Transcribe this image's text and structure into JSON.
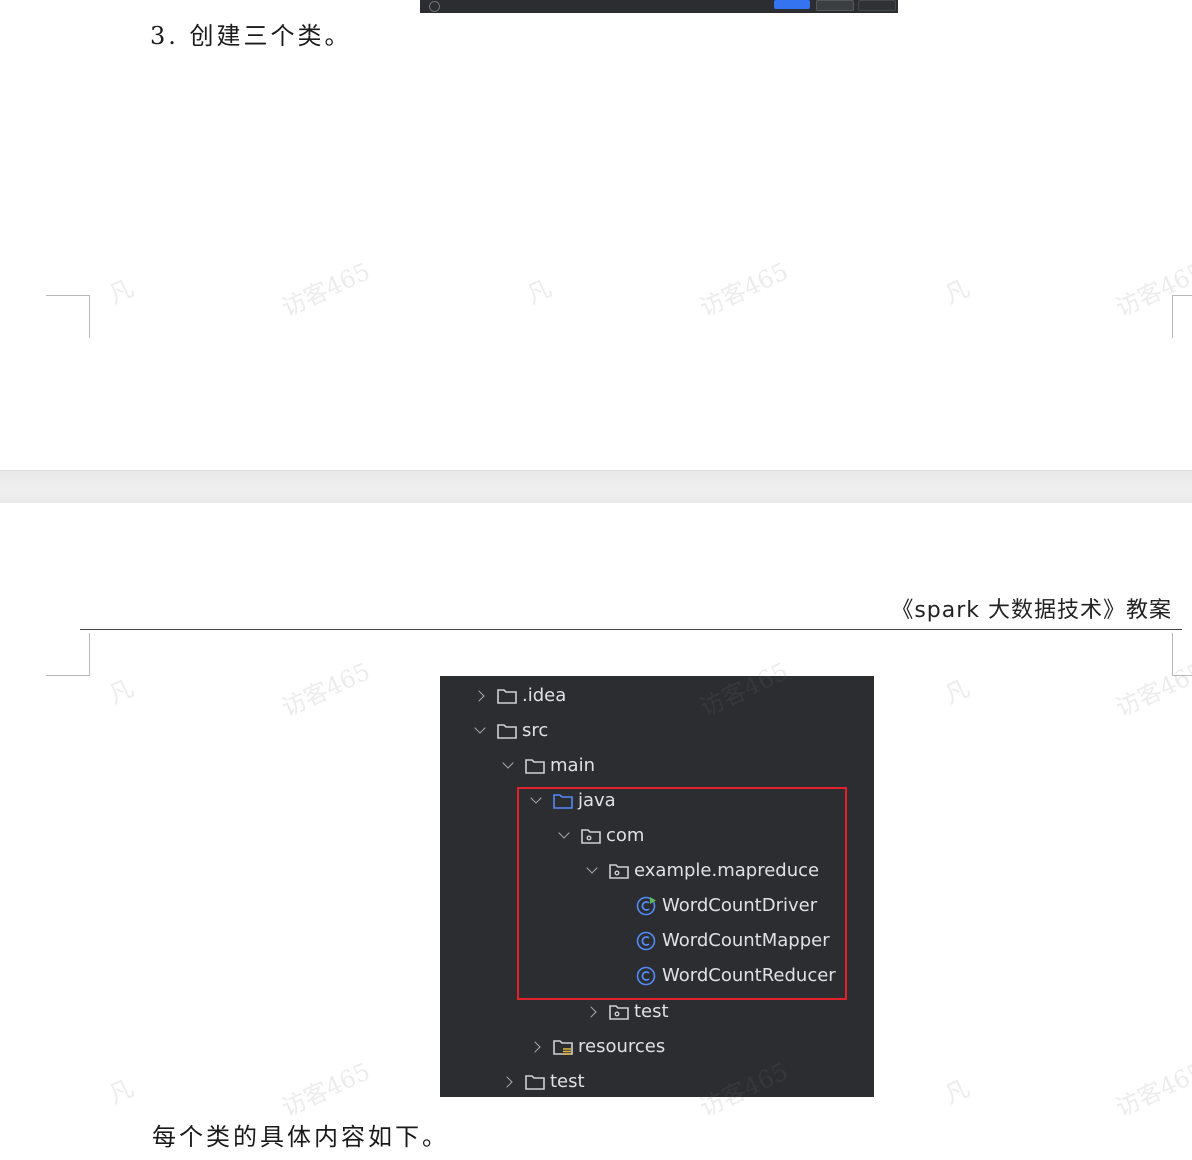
{
  "page1": {
    "step_text": "3. 创建三个类。"
  },
  "watermarks": [
    "凡",
    "访客465"
  ],
  "page2": {
    "header_text": "《spark 大数据技术》教案",
    "closing_text": "每个类的具体内容如下。"
  },
  "tree": {
    "items": [
      {
        "label": ".idea",
        "expanded": false,
        "icon": "folder-icon"
      },
      {
        "label": "src",
        "expanded": true,
        "icon": "folder-icon"
      },
      {
        "label": "main",
        "expanded": true,
        "icon": "folder-icon"
      },
      {
        "label": "java",
        "expanded": true,
        "icon": "source-folder-icon"
      },
      {
        "label": "com",
        "expanded": true,
        "icon": "package-icon"
      },
      {
        "label": "example.mapreduce",
        "expanded": true,
        "icon": "package-icon"
      },
      {
        "label": "WordCountDriver",
        "icon": "runnable-class-icon"
      },
      {
        "label": "WordCountMapper",
        "icon": "class-icon"
      },
      {
        "label": "WordCountReducer",
        "icon": "class-icon"
      },
      {
        "label": "test",
        "expanded": false,
        "icon": "package-icon"
      },
      {
        "label": "resources",
        "expanded": false,
        "icon": "resources-folder-icon"
      },
      {
        "label": "test",
        "expanded": false,
        "icon": "folder-icon"
      }
    ]
  },
  "colors": {
    "tree_bg": "#2b2d30",
    "tree_text": "#dfe1e5",
    "source_folder": "#3574f0",
    "class_icon": "#3574f0",
    "highlight": "#e3212b"
  }
}
